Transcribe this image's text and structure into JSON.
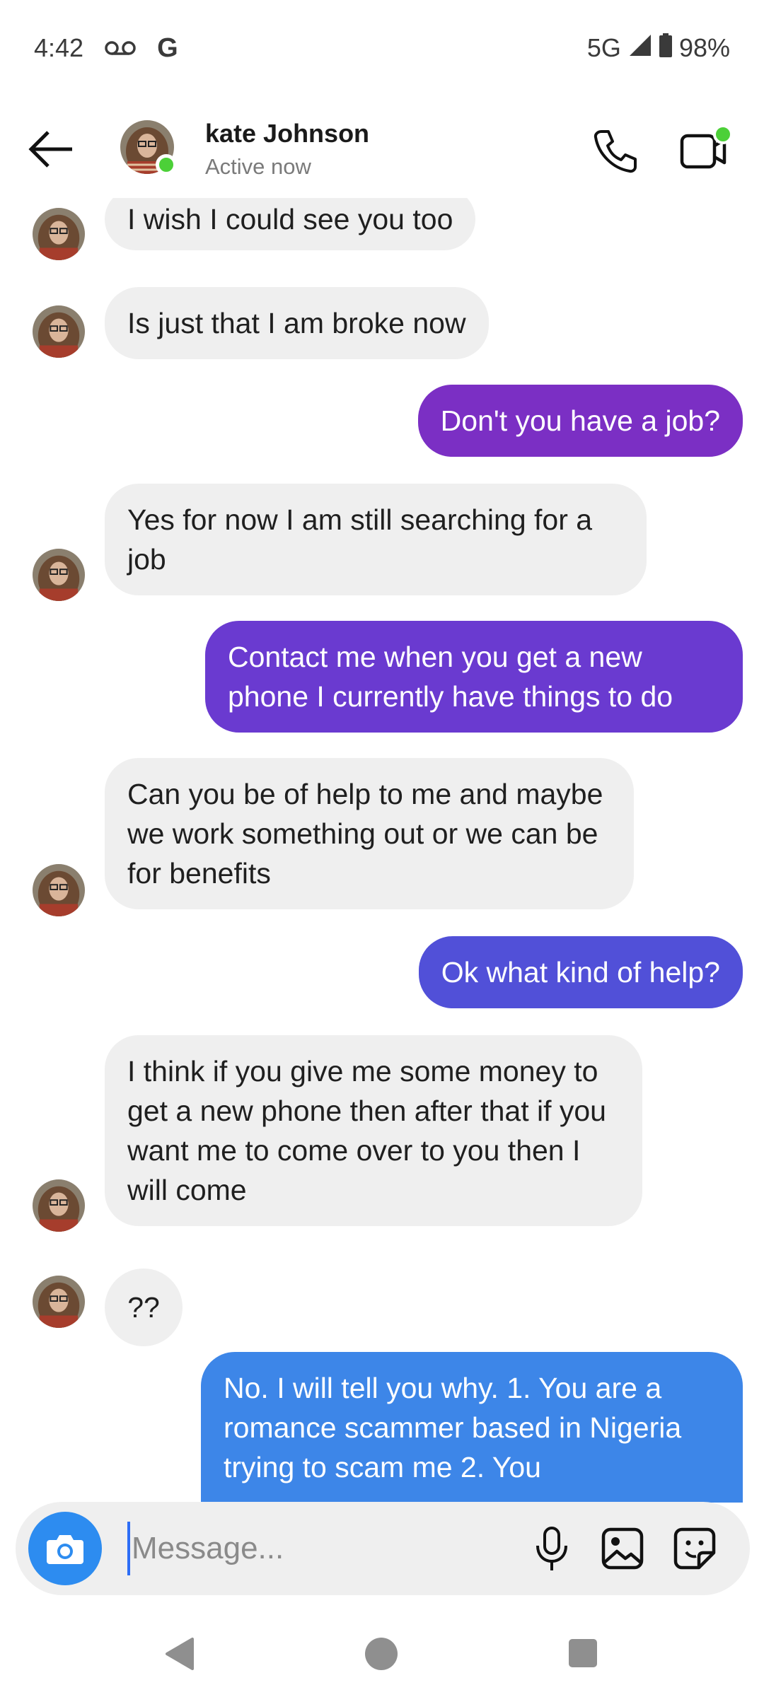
{
  "status_bar": {
    "time": "4:42",
    "google_mark": "G",
    "network": "5G",
    "battery": "98%"
  },
  "header": {
    "contact_name": "kate Johnson",
    "status": "Active now"
  },
  "messages": [
    {
      "sender": "contact",
      "text": "I wish I could see you too"
    },
    {
      "sender": "contact",
      "text": "Is just that I am broke now"
    },
    {
      "sender": "me",
      "text": "Don't you have a job?"
    },
    {
      "sender": "contact",
      "text": "Yes for now I am still searching for a job"
    },
    {
      "sender": "me",
      "text": "Contact me when you get a new phone I currently have things to do"
    },
    {
      "sender": "contact",
      "text": "Can you be of help to me and maybe we work something out or we can be for benefits"
    },
    {
      "sender": "me",
      "text": "Ok what kind of help?"
    },
    {
      "sender": "contact",
      "text": "I think if you give me some money to get a new phone then after that if you want me to come over to you then I will come"
    },
    {
      "sender": "contact",
      "text": "??"
    },
    {
      "sender": "me",
      "text": "No. I will tell you why. 1.  You are a romance scammer based in Nigeria trying to scam me 2. You"
    }
  ],
  "composer": {
    "placeholder": "Message..."
  },
  "colors": {
    "bubble_purple": "#7b2fc4",
    "bubble_violet": "#6a3ad0",
    "bubble_indigo": "#5150d8",
    "bubble_blue": "#3d86e8",
    "incoming_bubble": "#efefef",
    "online_green": "#4cd038",
    "camera_blue": "#2d8cf0"
  }
}
